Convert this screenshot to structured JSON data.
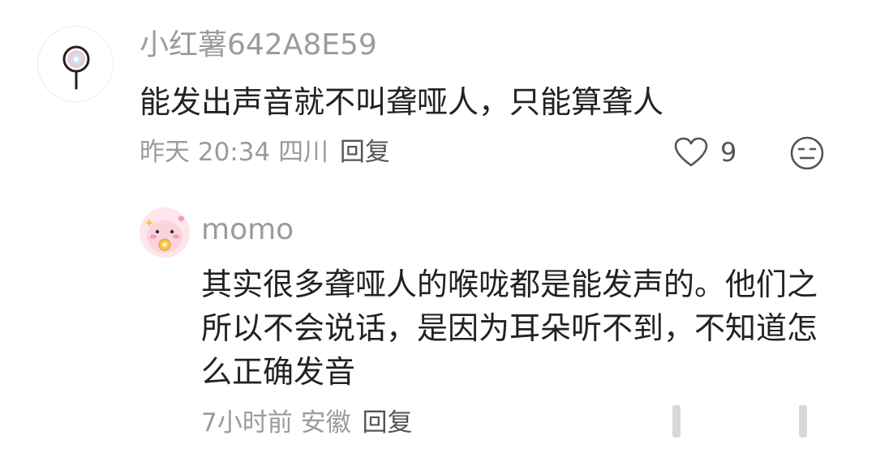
{
  "comment": {
    "username": "小红薯642A8E59",
    "text": "能发出声音就不叫聋哑人，只能算聋人",
    "time": "昨天 20:34",
    "location": "四川",
    "reply_label": "回复",
    "like_count": "9",
    "like_icon": "heart-outline-icon",
    "emoji_icon": "neutral-face-icon"
  },
  "reply": {
    "username": "momo",
    "text": "其实很多聋哑人的喉咙都是能发声的。他们之所以不会说话，是因为耳朵听不到，不知道怎么正确发音",
    "time": "7小时前",
    "location": "安徽",
    "reply_label": "回复"
  },
  "colors": {
    "text_primary": "#222222",
    "text_secondary": "#9b9b9b",
    "avatar2_bg": "#fde6ec"
  }
}
